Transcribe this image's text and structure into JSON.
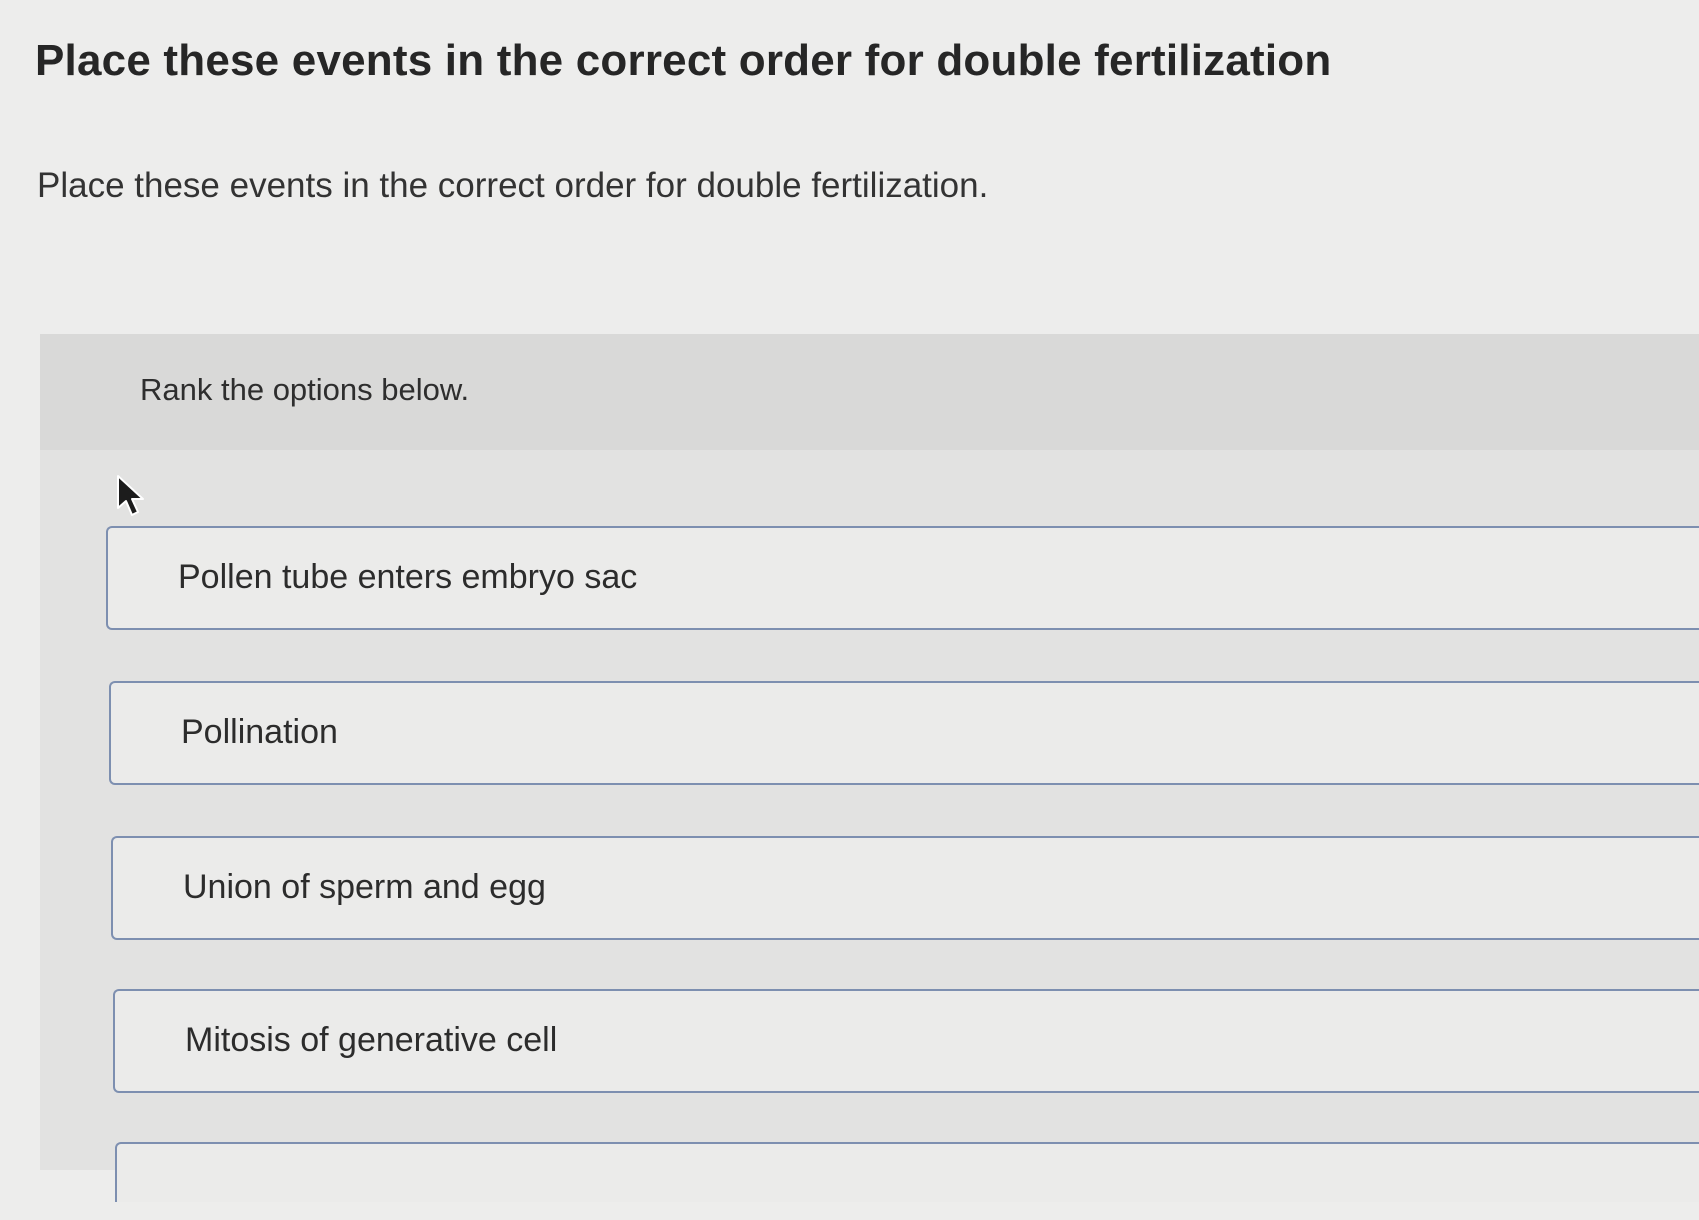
{
  "question": {
    "title": "Place these events in the correct order for double fertilization",
    "prompt": "Place these events in the correct order for double fertilization."
  },
  "ranking": {
    "instructions": "Rank the options below.",
    "items": [
      {
        "label": "Pollen tube enters embryo sac"
      },
      {
        "label": "Pollination"
      },
      {
        "label": "Union of sperm and egg"
      },
      {
        "label": "Mitosis of generative cell"
      },
      {
        "label": ""
      }
    ]
  },
  "icons": {
    "cursor": "mouse-pointer-icon"
  },
  "colors": {
    "item_border": "#7d8fb0",
    "panel_background": "#e2e2e1",
    "page_background": "#ededec"
  }
}
